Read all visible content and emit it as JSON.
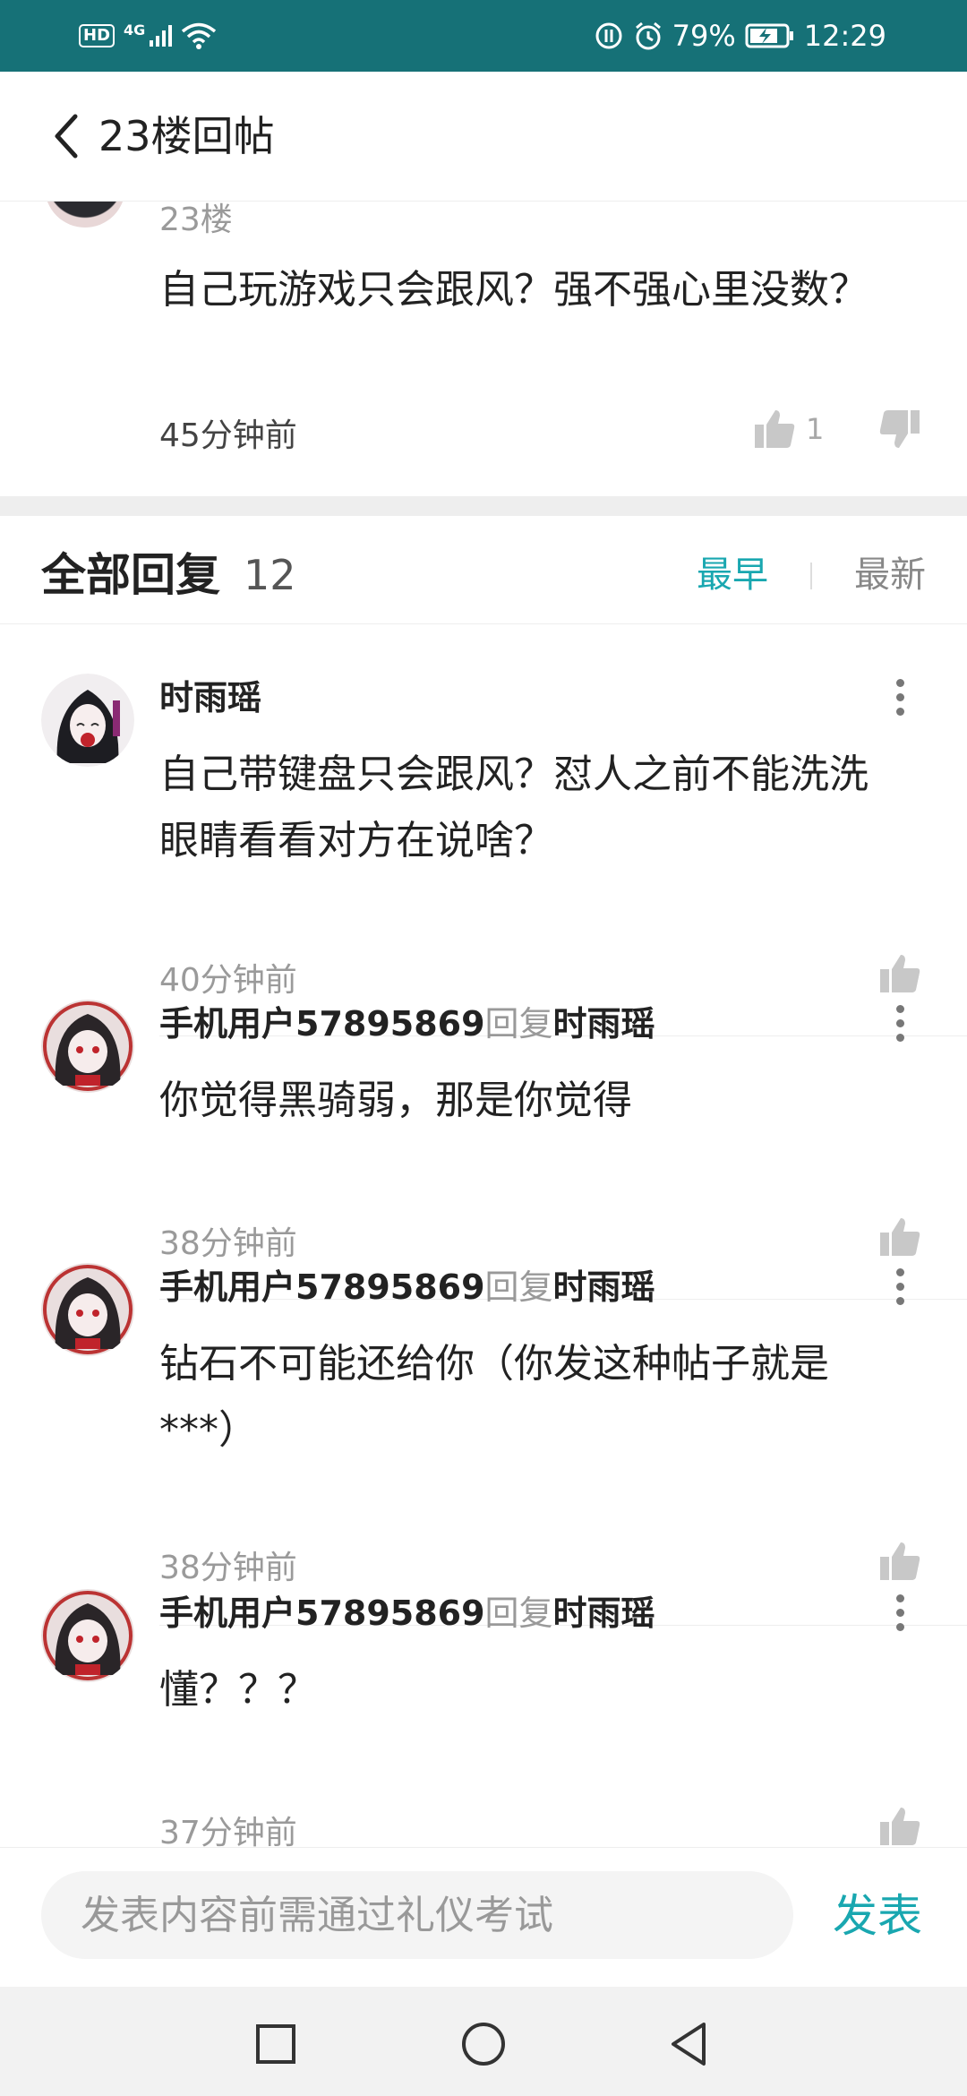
{
  "status_bar": {
    "network_badge": "HD",
    "network_type": "4G",
    "battery": "79%",
    "time": "12:29"
  },
  "header": {
    "title": "23楼回帖"
  },
  "post": {
    "floor": "23楼",
    "text": "自己玩游戏只会跟风？强不强心里没数？",
    "time": "45分钟前",
    "likes": "1"
  },
  "replies": {
    "title": "全部回复",
    "count": "12",
    "sort_earliest": "最早",
    "sort_latest": "最新",
    "active_sort_color": "#19a7b0",
    "items": [
      {
        "author": "时雨瑶",
        "reply_word": "",
        "reply_to": "",
        "text": "自己带键盘只会跟风？怼人之前不能洗洗眼睛看看对方在说啥？",
        "time": "40分钟前"
      },
      {
        "author": "手机用户57895869",
        "reply_word": "回复",
        "reply_to": "时雨瑶",
        "text": "你觉得黑骑弱，那是你觉得",
        "time": "38分钟前"
      },
      {
        "author": "手机用户57895869",
        "reply_word": "回复",
        "reply_to": "时雨瑶",
        "text": "钻石不可能还给你（你发这种帖子就是***）",
        "time": "38分钟前"
      },
      {
        "author": "手机用户57895869",
        "reply_word": "回复",
        "reply_to": "时雨瑶",
        "text": "懂？？？",
        "time": "37分钟前"
      }
    ]
  },
  "composer": {
    "placeholder": "发表内容前需通过礼仪考试",
    "submit_label": "发表"
  },
  "nav": {
    "icons": [
      "recents-square-icon",
      "home-circle-icon",
      "back-triangle-icon"
    ]
  },
  "colors": {
    "status_bar": "#167177",
    "accent": "#19a7b0"
  }
}
